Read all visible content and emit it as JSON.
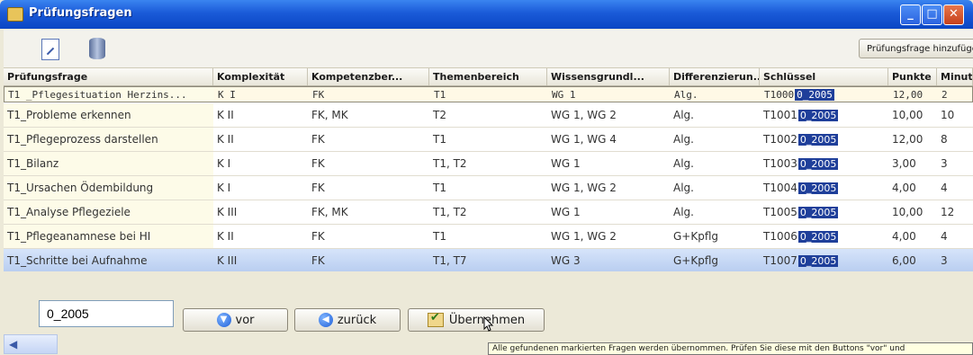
{
  "window": {
    "title": "Prüfungsfragen"
  },
  "toolbar": {
    "add_label": "Prüfungsfrage hinzufüge"
  },
  "grid": {
    "columns": [
      "Prüfungsfrage",
      "Komplexität",
      "Kompetenzber...",
      "Themenbereich",
      "Wissensgrundl...",
      "Differenzierun...",
      "Schlüssel",
      "Punkte",
      "Minute"
    ],
    "rows": [
      {
        "frage": "T1 _Pflegesituation Herzins...",
        "komplex": "K I",
        "kompetenz": "FK",
        "thema": "T1",
        "wissen": "WG 1",
        "diff": "Alg.",
        "key": "T1000",
        "key_suffix": "0_2005",
        "punkte": "12,00",
        "min": "2"
      },
      {
        "frage": "T1_Probleme erkennen",
        "komplex": "K II",
        "kompetenz": "FK, MK",
        "thema": "T2",
        "wissen": "WG 1, WG 2",
        "diff": "Alg.",
        "key": "T1001",
        "key_suffix": "0_2005",
        "punkte": "10,00",
        "min": "10"
      },
      {
        "frage": "T1_Pflegeprozess darstellen",
        "komplex": "K II",
        "kompetenz": "FK",
        "thema": "T1",
        "wissen": "WG 1, WG 4",
        "diff": "Alg.",
        "key": "T1002",
        "key_suffix": "0_2005",
        "punkte": "12,00",
        "min": "8"
      },
      {
        "frage": "T1_Bilanz",
        "komplex": "K I",
        "kompetenz": "FK",
        "thema": "T1, T2",
        "wissen": "WG 1",
        "diff": "Alg.",
        "key": "T1003",
        "key_suffix": "0_2005",
        "punkte": "3,00",
        "min": "3"
      },
      {
        "frage": "T1_Ursachen Ödembildung",
        "komplex": "K I",
        "kompetenz": "FK",
        "thema": "T1",
        "wissen": "WG 1, WG 2",
        "diff": "Alg.",
        "key": "T1004",
        "key_suffix": "0_2005",
        "punkte": "4,00",
        "min": "4"
      },
      {
        "frage": "T1_Analyse Pflegeziele",
        "komplex": "K III",
        "kompetenz": "FK, MK",
        "thema": "T1, T2",
        "wissen": "WG 1",
        "diff": "Alg.",
        "key": "T1005",
        "key_suffix": "0_2005",
        "punkte": "10,00",
        "min": "12"
      },
      {
        "frage": "T1_Pflegeanamnese bei HI",
        "komplex": "K II",
        "kompetenz": "FK",
        "thema": "T1",
        "wissen": "WG 1, WG 2",
        "diff": "G+Kpflg",
        "key": "T1006",
        "key_suffix": "0_2005",
        "punkte": "4,00",
        "min": "4"
      },
      {
        "frage": "T1_Schritte bei Aufnahme",
        "komplex": "K III",
        "kompetenz": "FK",
        "thema": "T1, T7",
        "wissen": "WG 3",
        "diff": "G+Kpflg",
        "key": "T1007",
        "key_suffix": "0_2005",
        "punkte": "6,00",
        "min": "3"
      }
    ]
  },
  "controls": {
    "search_value": "0_2005",
    "vor_label": "vor",
    "zurueck_label": "zurück",
    "uebernehmen_label": "Übernehmen"
  },
  "tooltip": "Alle gefundenen markierten Fragen werden übernommen. Prüfen Sie diese mit den Buttons \"vor\" und"
}
